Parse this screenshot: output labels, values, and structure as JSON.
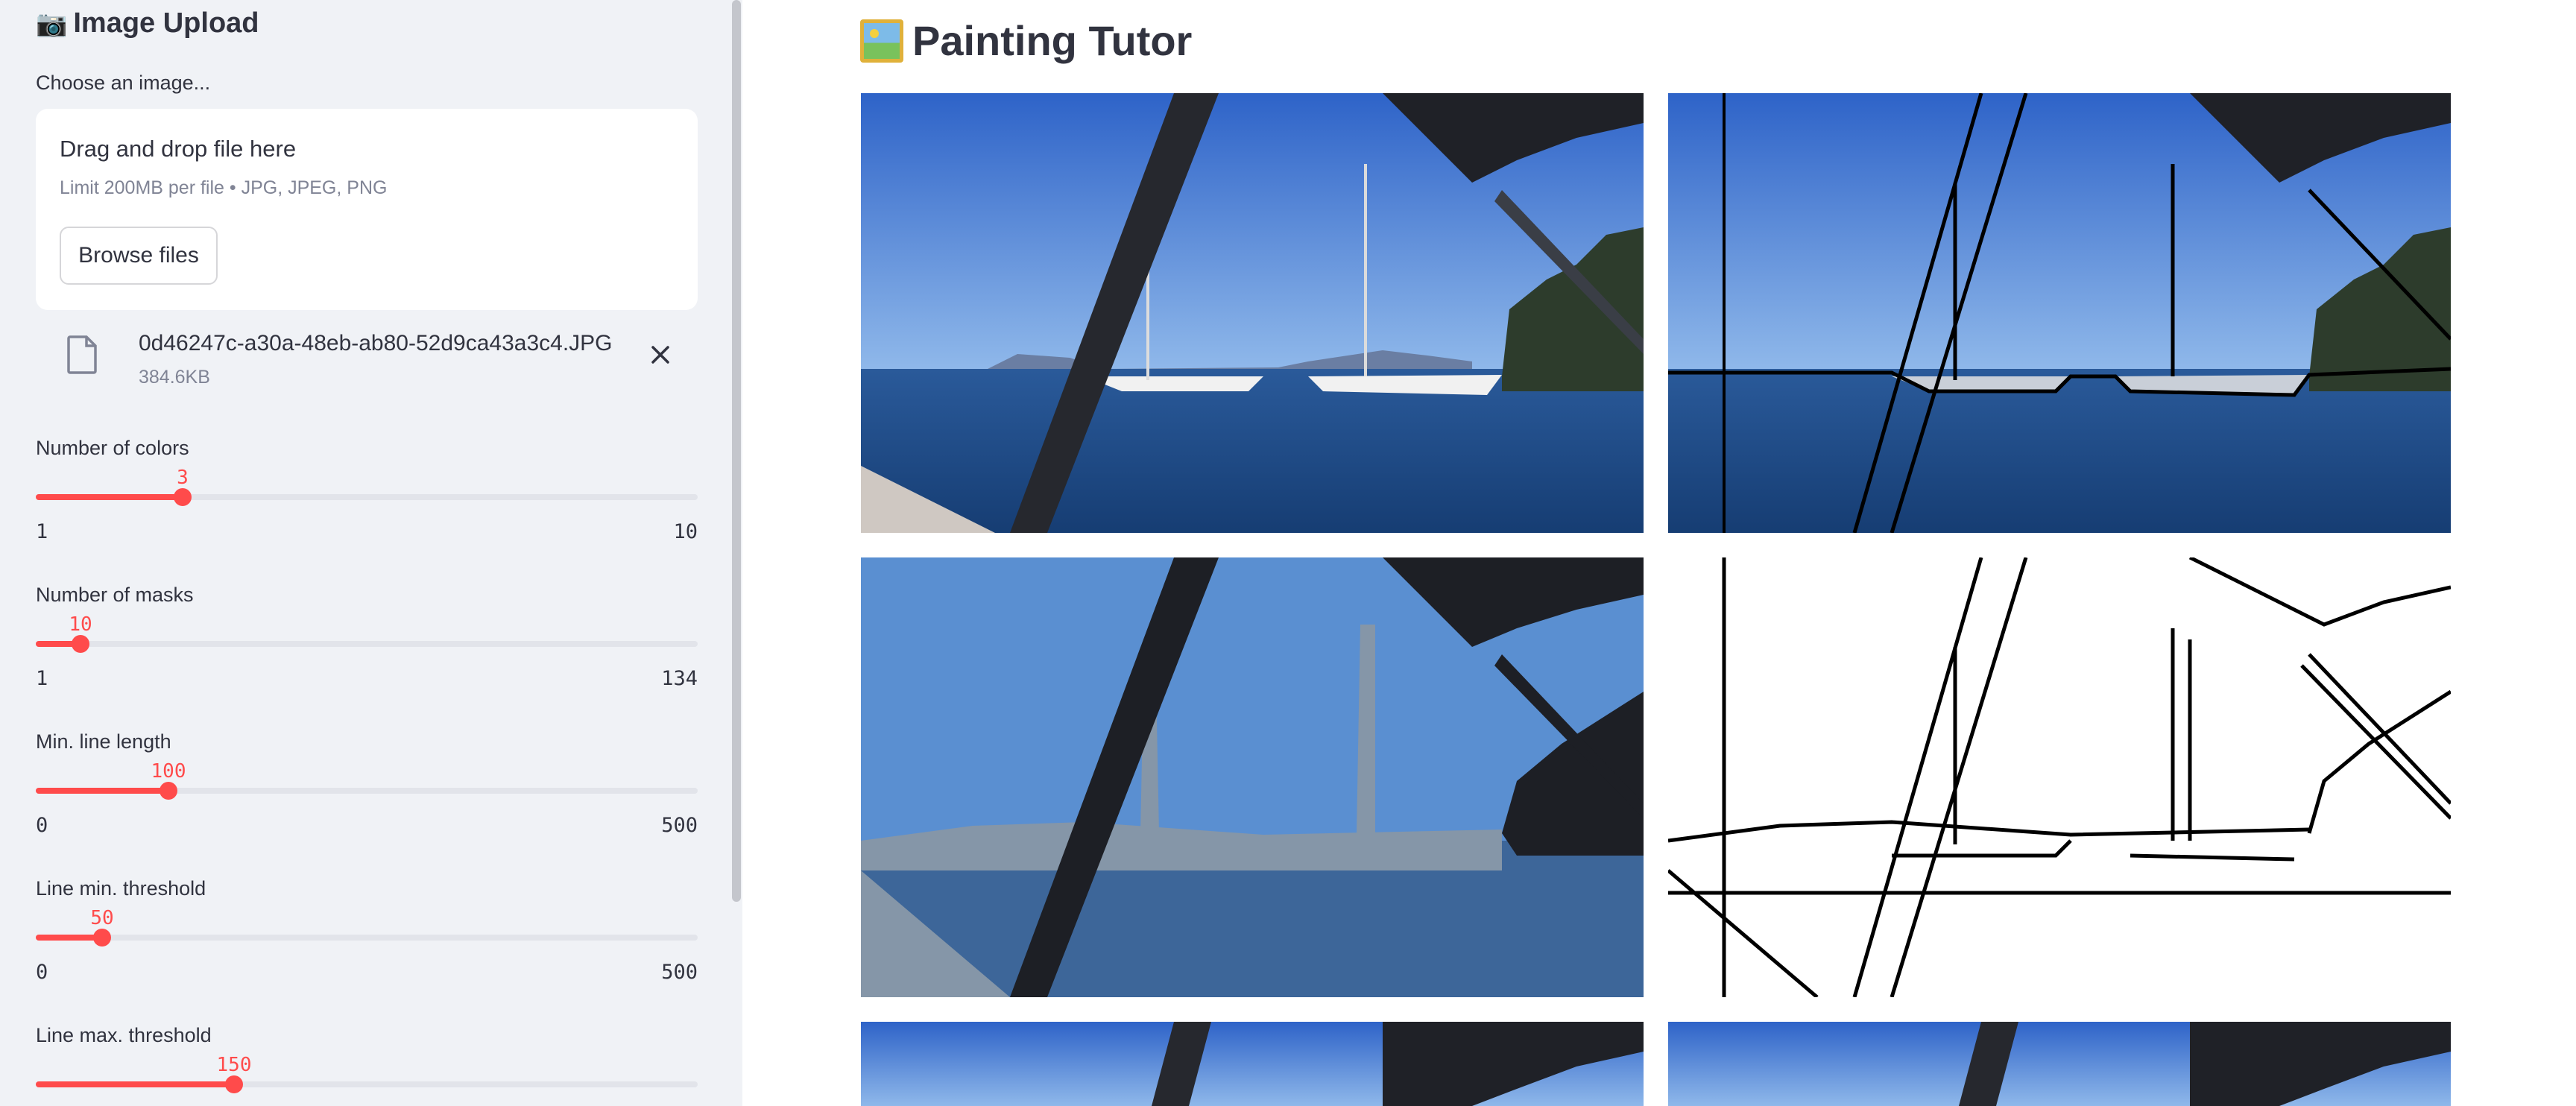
{
  "sidebar": {
    "header": {
      "emoji": "📷",
      "title": "Image Upload"
    },
    "upload": {
      "label": "Choose an image...",
      "drop_text": "Drag and drop file here",
      "limit_text": "Limit 200MB per file • JPG, JPEG, PNG",
      "browse_label": "Browse files"
    },
    "file": {
      "name": "0d46247c-a30a-48eb-ab80-52d9ca43a3c4.JPG",
      "size": "384.6KB",
      "close_icon": "close-icon",
      "file_icon": "file-icon"
    },
    "sliders": [
      {
        "label": "Number of colors",
        "value": "3",
        "min": "1",
        "max": "10",
        "fraction": 0.222
      },
      {
        "label": "Number of masks",
        "value": "10",
        "min": "1",
        "max": "134",
        "fraction": 0.068
      },
      {
        "label": "Min. line length",
        "value": "100",
        "min": "0",
        "max": "500",
        "fraction": 0.2
      },
      {
        "label": "Line min. threshold",
        "value": "50",
        "min": "0",
        "max": "500",
        "fraction": 0.1
      },
      {
        "label": "Line max. threshold",
        "value": "150",
        "min": "0",
        "max": "500",
        "fraction": 0.3
      }
    ],
    "accent_color": "#ff4b4b"
  },
  "main": {
    "title": "Painting Tutor",
    "title_icon": "framed-picture-icon",
    "images": [
      {
        "kind": "original-photo"
      },
      {
        "kind": "blurred-with-outlines"
      },
      {
        "kind": "color-quantized"
      },
      {
        "kind": "line-drawing"
      },
      {
        "kind": "original-photo"
      },
      {
        "kind": "original-photo"
      }
    ]
  }
}
